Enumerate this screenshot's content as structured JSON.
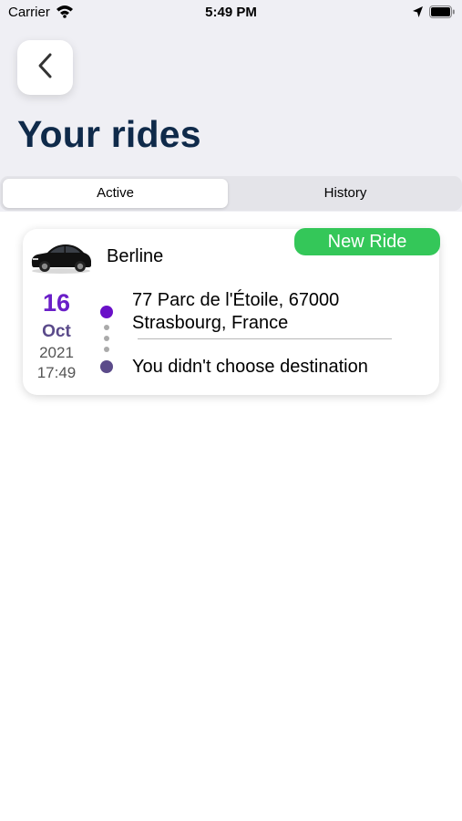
{
  "status_bar": {
    "carrier": "Carrier",
    "time": "5:49 PM",
    "icons": [
      "wifi-icon",
      "location-arrow-icon",
      "battery-icon"
    ]
  },
  "header": {
    "back_icon": "chevron-left-icon",
    "title": "Your rides"
  },
  "tabs": [
    {
      "label": "Active",
      "selected": true
    },
    {
      "label": "History",
      "selected": false
    }
  ],
  "rides": [
    {
      "car_type": "Berline",
      "car_icon": "black-sedan-car-image",
      "status": "New Ride",
      "date": {
        "day": "16",
        "month": "Oct",
        "year": "2021",
        "time": "17:49"
      },
      "pickup": "77 Parc de l'Étoile, 67000 Strasbourg, France",
      "dropoff": "You didn't choose destination"
    }
  ],
  "colors": {
    "header_background": "#efeff4",
    "title": "#0f2a4a",
    "status_badge": "#34c759",
    "date_day": "#6a1fc8",
    "date_month": "#5a4a8a",
    "pickup_dot": "#6a10c8",
    "dropoff_dot": "#5b4b8a"
  }
}
